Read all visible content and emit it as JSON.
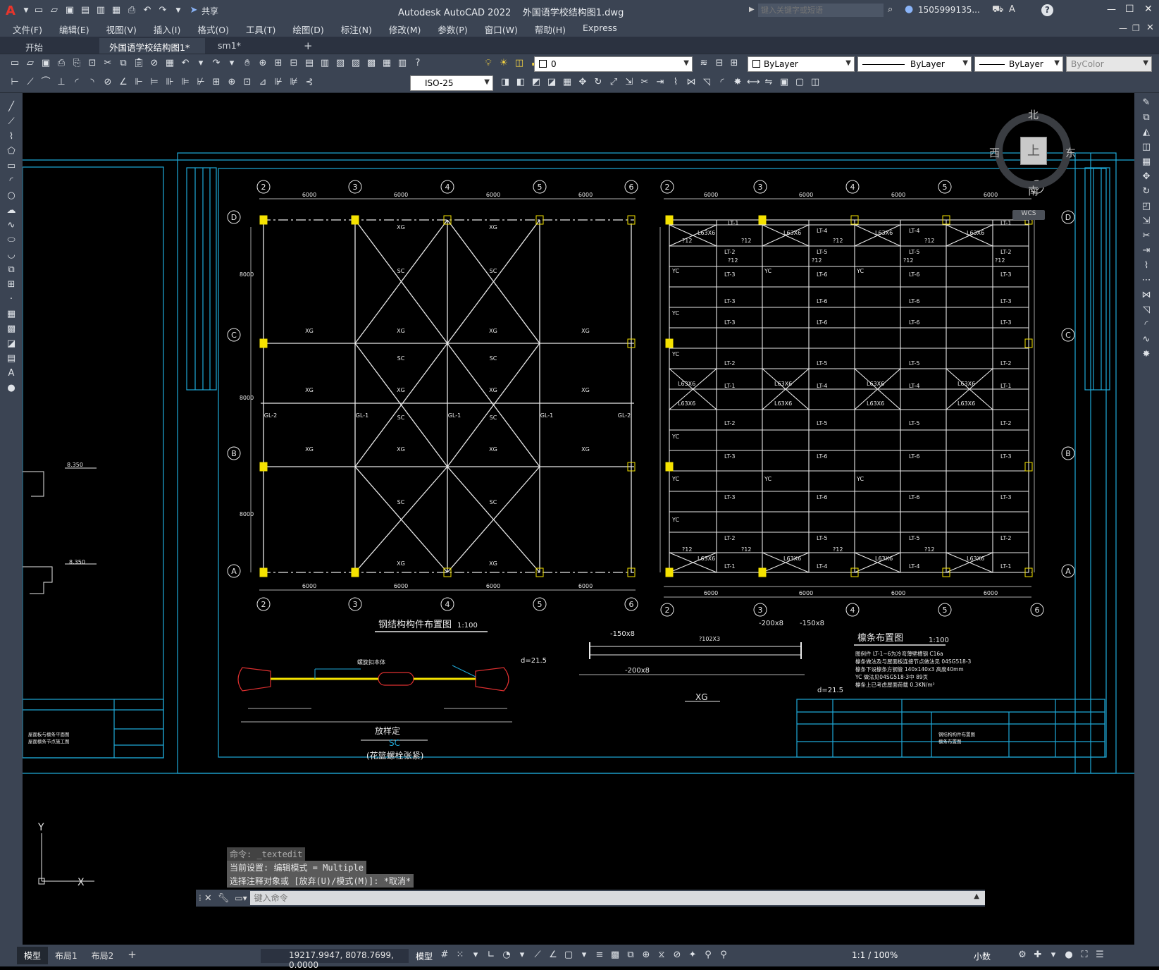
{
  "app": {
    "logo": "A",
    "title": "Autodesk AutoCAD 2022    外国语学校结构图1.dwg",
    "share": "共享",
    "search_placeholder": "键入关键字或短语",
    "user": "1505999135...",
    "window_controls": [
      "—",
      "☐",
      "✕"
    ]
  },
  "menu": [
    "文件(F)",
    "编辑(E)",
    "视图(V)",
    "插入(I)",
    "格式(O)",
    "工具(T)",
    "绘图(D)",
    "标注(N)",
    "修改(M)",
    "参数(P)",
    "窗口(W)",
    "帮助(H)",
    "Express"
  ],
  "tabs": [
    {
      "label": "开始",
      "active": false
    },
    {
      "label": "外国语学校结构图1*",
      "active": true,
      "close": "✕"
    },
    {
      "label": "sm1*",
      "active": false
    }
  ],
  "tab_add": "+",
  "layer": {
    "current": "0",
    "color": "ByLayer",
    "linetype": "ByLayer",
    "lineweight": "ByLayer",
    "plotstyle": "ByColor"
  },
  "dimstyle": "ISO-25",
  "viewcube": {
    "north": "北",
    "south": "南",
    "east": "东",
    "west": "西",
    "top": "上",
    "wcs": "WCS"
  },
  "drawing": {
    "axes_top": [
      "2",
      "3",
      "4",
      "5",
      "6"
    ],
    "rows": [
      "D",
      "C",
      "B",
      "A"
    ],
    "span": "6000",
    "bay": "8000",
    "title1": "钢结构构件布置图",
    "scale1": "1:100",
    "title2": "檩条布置图",
    "scale2": "1:100",
    "labels": {
      "xg": "XG",
      "sc": "SC",
      "lt1": "LT-1",
      "lt2": "LT-2",
      "lt3": "LT-3",
      "lt4": "LT-4",
      "lt5": "LT-5",
      "lt6": "LT-6",
      "l63": "L63X6",
      "phi12": "?12",
      "yc": "YC",
      "gl1": "GL-1",
      "gl2": "GL-2"
    },
    "sc_detail": {
      "title": "放样定",
      "sub": "SC",
      "caption": "(花篮螺栓张紧)",
      "d": "d=21.5",
      "note": "螺旋扣本体"
    },
    "xg_detail": {
      "title": "XG",
      "p1": "-150x8",
      "p2": "-200x8",
      "p3": "-150x8",
      "p4": "-200x8",
      "d": "d=21.5",
      "pipe": "?102X3"
    },
    "notes": [
      "图例件 LT-1~6为冷弯薄壁槽钢 C16a",
      "檩条做法及与屋面板连接节点做法见 04SG518-3",
      "檩条下设檩条方钢管 140x140x3 高度40mm",
      "YC 做法见04SG518-3中 89页",
      "檩条上已考虑屋面荷载 0.3KN/m²"
    ],
    "elev": "8.350",
    "left_caption": [
      "屋面板与檩条平面图",
      "屋面檩条节点施工图"
    ],
    "right_caption": [
      "钢结构构件布置图",
      "檩条布置图"
    ]
  },
  "ucs": {
    "x": "X",
    "y": "Y"
  },
  "command": {
    "lines": [
      "命令: _textedit",
      "当前设置: 编辑模式 = Multiple",
      "选择注释对象或 [放弃(U)/模式(M)]: *取消*"
    ],
    "placeholder": "键入命令"
  },
  "layouts": [
    "模型",
    "布局1",
    "布局2"
  ],
  "status": {
    "coords": "19217.9947, 8078.7699, 0.0000",
    "space": "模型",
    "scale": "1:1 / 100%",
    "units": "小数"
  }
}
